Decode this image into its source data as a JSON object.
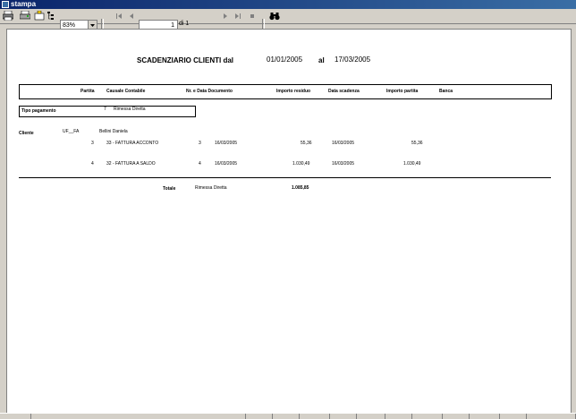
{
  "window": {
    "title": "stampa"
  },
  "toolbar": {
    "zoom": "83%",
    "page": "1",
    "of_pages": "di 1"
  },
  "report": {
    "title": "SCADENZIARIO CLIENTI dal",
    "date_from": "01/01/2005",
    "al_label": "al",
    "date_to": "17/03/2005",
    "headers": {
      "partita": "Partita",
      "causale": "Causale Contabile",
      "nr_data": "Nr. e Data Documento",
      "importo_residuo": "Importo residuo",
      "data_scadenza": "Data scadenza",
      "importo_partita": "Importo partita",
      "banca": "Banca"
    },
    "tipo_pagamento": {
      "label": "Tipo pagamento",
      "code": "7",
      "desc": "Rimessa Diretta"
    },
    "cliente": {
      "label": "Cliente",
      "code": "UF__FA",
      "name": "Bellini Daniela"
    },
    "rows": [
      {
        "partita": "3",
        "causale": "33 - FATTURA ACCONTO",
        "nr": "3",
        "data": "16/03/2005",
        "residuo": "55,36",
        "scadenza": "16/03/2005",
        "importo": "55,36"
      },
      {
        "partita": "4",
        "causale": "32 - FATTURA A SALDO",
        "nr": "4",
        "data": "16/03/2005",
        "residuo": "1.030,49",
        "scadenza": "16/03/2005",
        "importo": "1.030,49"
      }
    ],
    "totale": {
      "label": "Totale",
      "desc": "Rimessa Diretta",
      "value": "1.085,85"
    }
  }
}
